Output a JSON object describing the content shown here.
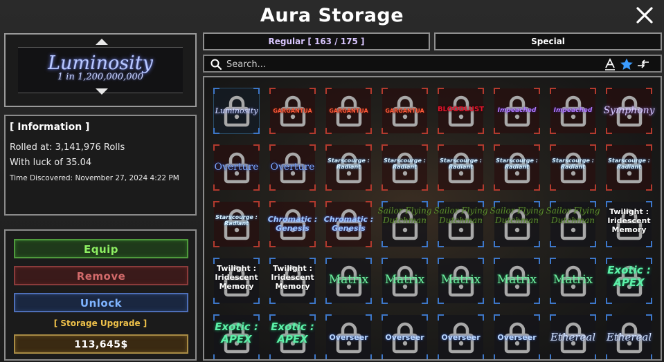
{
  "window": {
    "title": "Aura Storage"
  },
  "selected_aura": {
    "name": "Luminosity",
    "rarity": "1 in 1,200,000,000"
  },
  "information": {
    "title": "[ Information ]",
    "rolled_at": "Rolled at: 3,141,976 Rolls",
    "luck": "With luck of 35.04",
    "discovered": "Time Discovered: November 27, 2024 4:22 PM"
  },
  "actions": {
    "equip": "Equip",
    "remove": "Remove",
    "unlock": "Unlock",
    "storage_upgrade": "[ Storage Upgrade ]",
    "price": "113,645$"
  },
  "tabs": {
    "regular": "Regular [ 163 / 175 ]",
    "special": "Special"
  },
  "search": {
    "placeholder": "Search..."
  },
  "colors": {
    "frame_blue": "#3d77c9",
    "frame_red": "#b33a2e",
    "equip_green": "#8ef062",
    "unlock_blue": "#7fb4ff",
    "upgrade_gold": "#f0c24a"
  },
  "icons": {
    "close": "close-icon",
    "search": "search-icon",
    "sort_alpha": "sort-alphabetical-icon",
    "favorite": "star-icon",
    "swap": "swap-arrows-icon",
    "lock": "lock-icon"
  },
  "slots": [
    {
      "label": "Luminosity",
      "style": "luminosity",
      "frame": "blue"
    },
    {
      "label": "GARGANTUA",
      "style": "gargantua",
      "frame": "red"
    },
    {
      "label": "GARGANTUA",
      "style": "gargantua",
      "frame": "red"
    },
    {
      "label": "GARGANTUA",
      "style": "gargantua",
      "frame": "red"
    },
    {
      "label": "BLOODLUST",
      "style": "bloodlust",
      "frame": "red"
    },
    {
      "label": "Impeached",
      "style": "impeached",
      "frame": "red"
    },
    {
      "label": "Impeached",
      "style": "impeached",
      "frame": "red"
    },
    {
      "label": "Symphony",
      "style": "symphony",
      "frame": "red"
    },
    {
      "label": "Overture",
      "style": "overture",
      "frame": "red"
    },
    {
      "label": "Overture",
      "style": "overture",
      "frame": "red"
    },
    {
      "label": "Starscourge : Radiant",
      "style": "starscourge",
      "frame": "red"
    },
    {
      "label": "Starscourge : Radiant",
      "style": "starscourge",
      "frame": "red"
    },
    {
      "label": "Starscourge : Radiant",
      "style": "starscourge",
      "frame": "red"
    },
    {
      "label": "Starscourge : Radiant",
      "style": "starscourge",
      "frame": "red"
    },
    {
      "label": "Starscourge : Radiant",
      "style": "starscourge",
      "frame": "red"
    },
    {
      "label": "Starscourge : Radiant",
      "style": "starscourge",
      "frame": "red"
    },
    {
      "label": "Starscourge : Radiant",
      "style": "starscourge",
      "frame": "red"
    },
    {
      "label": "Chromatic : Genesis",
      "style": "chromatic",
      "frame": "red"
    },
    {
      "label": "Chromatic : Genesis",
      "style": "chromatic",
      "frame": "red"
    },
    {
      "label": "Sailor Flying Dutchman",
      "style": "sailor",
      "frame": "blue"
    },
    {
      "label": "Sailor Flying Dutchman",
      "style": "sailor",
      "frame": "blue"
    },
    {
      "label": "Sailor Flying Dutchman",
      "style": "sailor",
      "frame": "blue"
    },
    {
      "label": "Sailor Flying Dutchman",
      "style": "sailor",
      "frame": "blue"
    },
    {
      "label": "Twilight : Iridescent Memory",
      "style": "twilight",
      "frame": "blue"
    },
    {
      "label": "Twilight : Iridescent Memory",
      "style": "twilight",
      "frame": "blue"
    },
    {
      "label": "Twilight : Iridescent Memory",
      "style": "twilight",
      "frame": "blue"
    },
    {
      "label": "Matrix",
      "style": "matrix",
      "frame": "blue"
    },
    {
      "label": "Matrix",
      "style": "matrix",
      "frame": "blue"
    },
    {
      "label": "Matrix",
      "style": "matrix",
      "frame": "blue"
    },
    {
      "label": "Matrix",
      "style": "matrix",
      "frame": "blue"
    },
    {
      "label": "Matrix",
      "style": "matrix",
      "frame": "blue"
    },
    {
      "label": "Exotic : APEX",
      "style": "exotic",
      "frame": "blue"
    },
    {
      "label": "Exotic : APEX",
      "style": "exotic",
      "frame": "blue"
    },
    {
      "label": "Exotic : APEX",
      "style": "exotic",
      "frame": "blue"
    },
    {
      "label": "Overseer",
      "style": "overseer",
      "frame": "blue"
    },
    {
      "label": "Overseer",
      "style": "overseer",
      "frame": "blue"
    },
    {
      "label": "Overseer",
      "style": "overseer",
      "frame": "blue"
    },
    {
      "label": "Overseer",
      "style": "overseer",
      "frame": "blue"
    },
    {
      "label": "Ethereal",
      "style": "ethereal",
      "frame": "blue"
    },
    {
      "label": "Ethereal",
      "style": "ethereal",
      "frame": "blue"
    }
  ]
}
